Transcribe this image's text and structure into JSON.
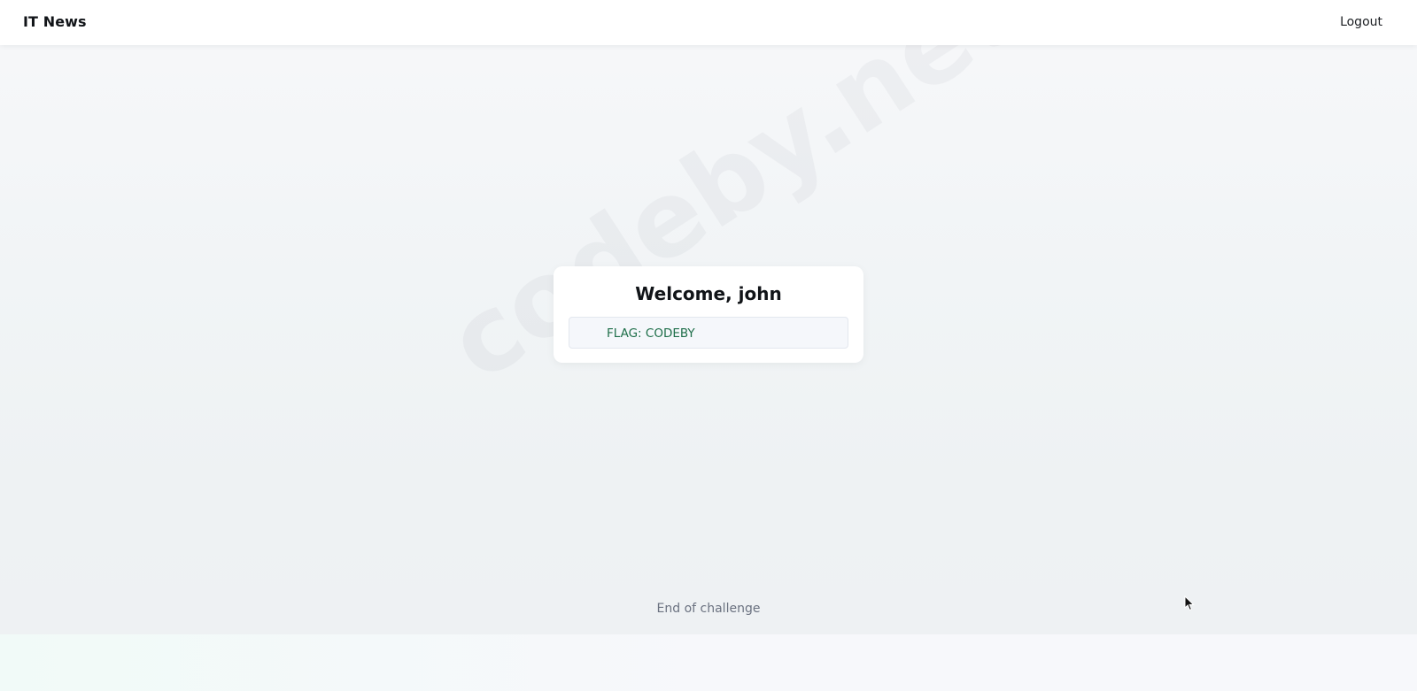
{
  "header": {
    "brand": "IT News",
    "logout_label": "Logout"
  },
  "watermark": {
    "text": "codeby.net"
  },
  "card": {
    "title": "Welcome, john",
    "flag_text": "FLAG: CODEBY"
  },
  "footer": {
    "text": "End of challenge"
  },
  "colors": {
    "flag_text": "#1f6f4a",
    "title": "#111418",
    "muted": "#6b7280"
  },
  "icons": {
    "cursor": "mouse-pointer-icon"
  }
}
